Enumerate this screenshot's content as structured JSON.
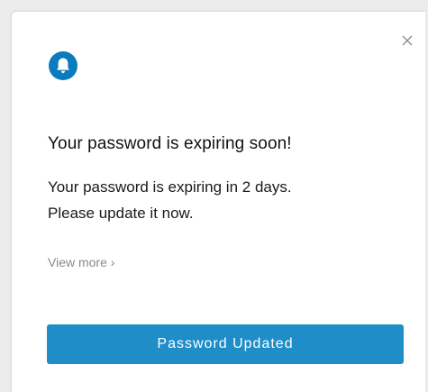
{
  "notification": {
    "title": "Your password is expiring soon!",
    "message_lines": [
      "Your password is expiring in 2 days.",
      "Please update it now."
    ],
    "view_more_label": "View more ›",
    "primary_button_label": "Password Updated",
    "icons": {
      "close": "close-icon",
      "bell": "bell-icon"
    },
    "colors": {
      "accent": "#1f8dc8",
      "bell_badge": "#0a7bbd",
      "link": "#8a8a8a"
    }
  }
}
